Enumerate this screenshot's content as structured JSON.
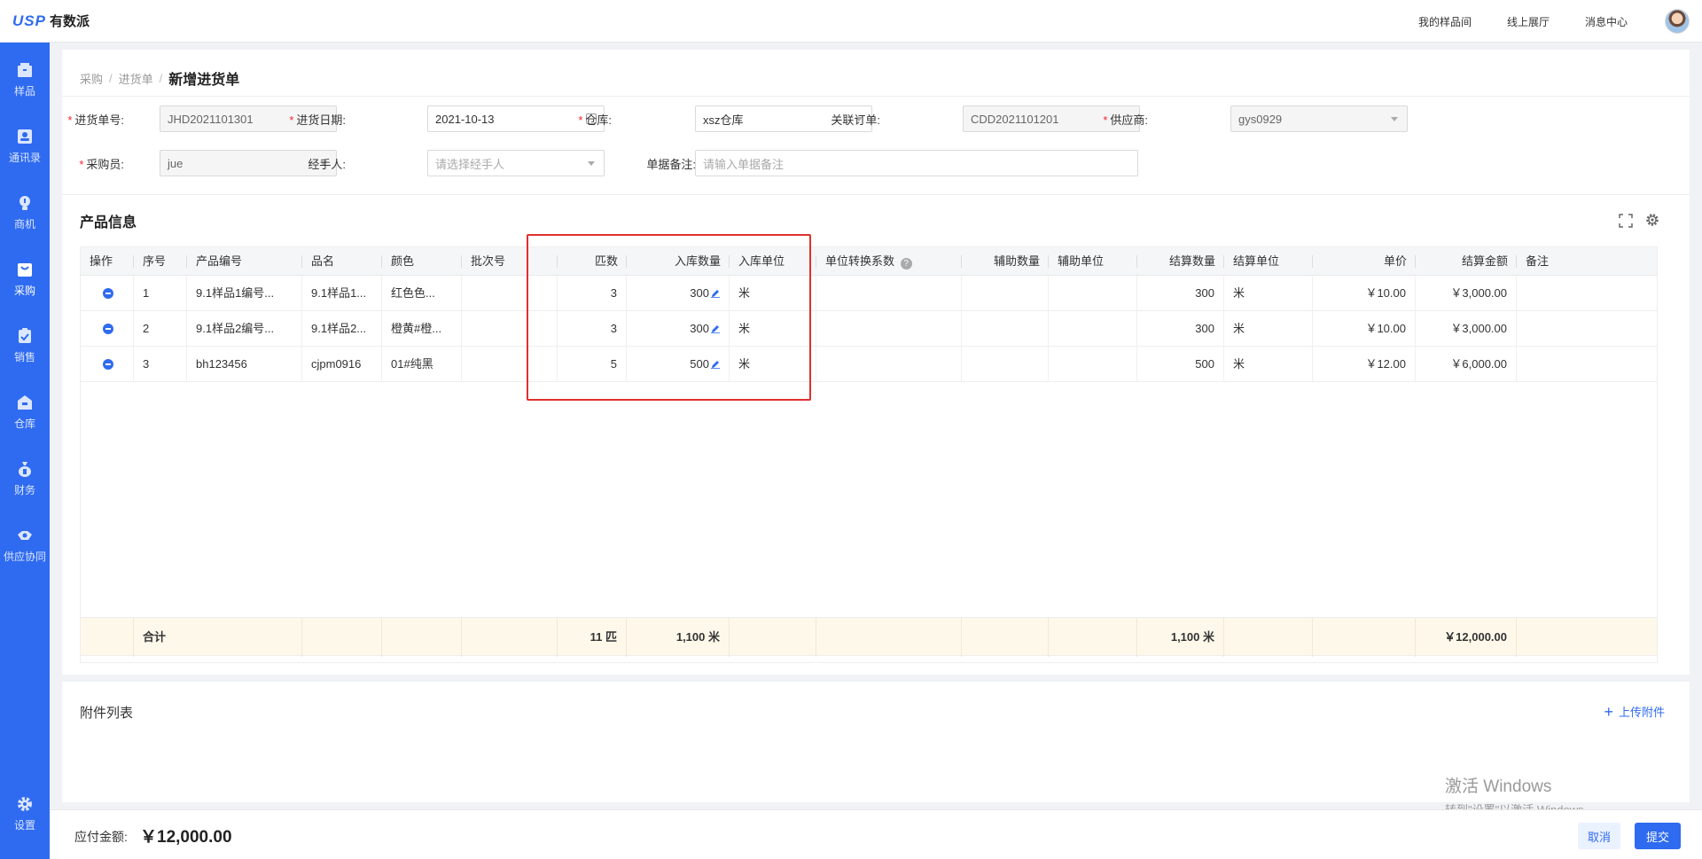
{
  "app": {
    "logo_mark": "USP",
    "logo_name": "有数派"
  },
  "topnav": {
    "links": [
      "我的样品间",
      "线上展厅",
      "消息中心"
    ]
  },
  "sidebar": {
    "items": [
      {
        "label": "样品",
        "icon": "box-icon"
      },
      {
        "label": "通讯录",
        "icon": "contacts-icon"
      },
      {
        "label": "商机",
        "icon": "lightbulb-icon"
      },
      {
        "label": "采购",
        "icon": "cart-icon",
        "active": true
      },
      {
        "label": "销售",
        "icon": "clipboard-icon"
      },
      {
        "label": "仓库",
        "icon": "warehouse-icon"
      },
      {
        "label": "财务",
        "icon": "money-bag-icon"
      },
      {
        "label": "供应协同",
        "icon": "handshake-icon"
      },
      {
        "label": "设置",
        "icon": "gear-icon"
      }
    ]
  },
  "breadcrumb": {
    "items": [
      "采购",
      "进货单"
    ],
    "current": "新增进货单",
    "separator": "/"
  },
  "form": {
    "order_no": {
      "label": "进货单号:",
      "value": "JHD2021101301"
    },
    "date": {
      "label": "进货日期:",
      "value": "2021-10-13"
    },
    "warehouse": {
      "label": "仓库:",
      "value": "xsz仓库"
    },
    "linked_order": {
      "label": "关联订单:",
      "value": "CDD2021101201"
    },
    "supplier": {
      "label": "供应商:",
      "value": "gys0929"
    },
    "buyer": {
      "label": "采购员:",
      "value": "jue"
    },
    "handler": {
      "label": "经手人:",
      "placeholder": "请选择经手人"
    },
    "remark": {
      "label": "单据备注:",
      "placeholder": "请输入单据备注"
    }
  },
  "product_section": {
    "title": "产品信息"
  },
  "table": {
    "headers": [
      "操作",
      "序号",
      "产品编号",
      "品名",
      "颜色",
      "批次号",
      "匹数",
      "入库数量",
      "入库单位",
      "单位转换系数",
      "辅助数量",
      "辅助单位",
      "结算数量",
      "结算单位",
      "单价",
      "结算金额",
      "备注"
    ],
    "rows": [
      {
        "seq": "1",
        "code": "9.1样品1编号...",
        "name": "9.1样品1...",
        "color": "红色色...",
        "batch": "",
        "pieces": "3",
        "qty": "300",
        "unit": "米",
        "factor": "",
        "aux_qty": "",
        "aux_unit": "",
        "settle_qty": "300",
        "settle_unit": "米",
        "price": "￥10.00",
        "amount": "￥3,000.00",
        "note": ""
      },
      {
        "seq": "2",
        "code": "9.1样品2编号...",
        "name": "9.1样品2...",
        "color": "橙黄#橙...",
        "batch": "",
        "pieces": "3",
        "qty": "300",
        "unit": "米",
        "factor": "",
        "aux_qty": "",
        "aux_unit": "",
        "settle_qty": "300",
        "settle_unit": "米",
        "price": "￥10.00",
        "amount": "￥3,000.00",
        "note": ""
      },
      {
        "seq": "3",
        "code": "bh123456",
        "name": "cjpm0916",
        "color": "01#纯黑",
        "batch": "",
        "pieces": "5",
        "qty": "500",
        "unit": "米",
        "factor": "",
        "aux_qty": "",
        "aux_unit": "",
        "settle_qty": "500",
        "settle_unit": "米",
        "price": "￥12.00",
        "amount": "￥6,000.00",
        "note": ""
      }
    ],
    "footer": {
      "label": "合计",
      "pieces": "11 匹",
      "qty": "1,100 米",
      "settle_qty": "1,100 米",
      "amount": "￥12,000.00"
    }
  },
  "attachments": {
    "title": "附件列表",
    "upload_label": "上传附件"
  },
  "watermark": {
    "line1": "激活 Windows",
    "line2": "转到\"设置\"以激活 Windows。"
  },
  "bottom": {
    "due_label": "应付金额:",
    "due_value": "￥12,000.00",
    "cancel_label": "取消",
    "submit_label": "提交"
  },
  "colors": {
    "primary": "#2f6bf0",
    "required": "#f5222d",
    "highlight": "#e0302f",
    "footer_bg": "#fdf8ea"
  }
}
